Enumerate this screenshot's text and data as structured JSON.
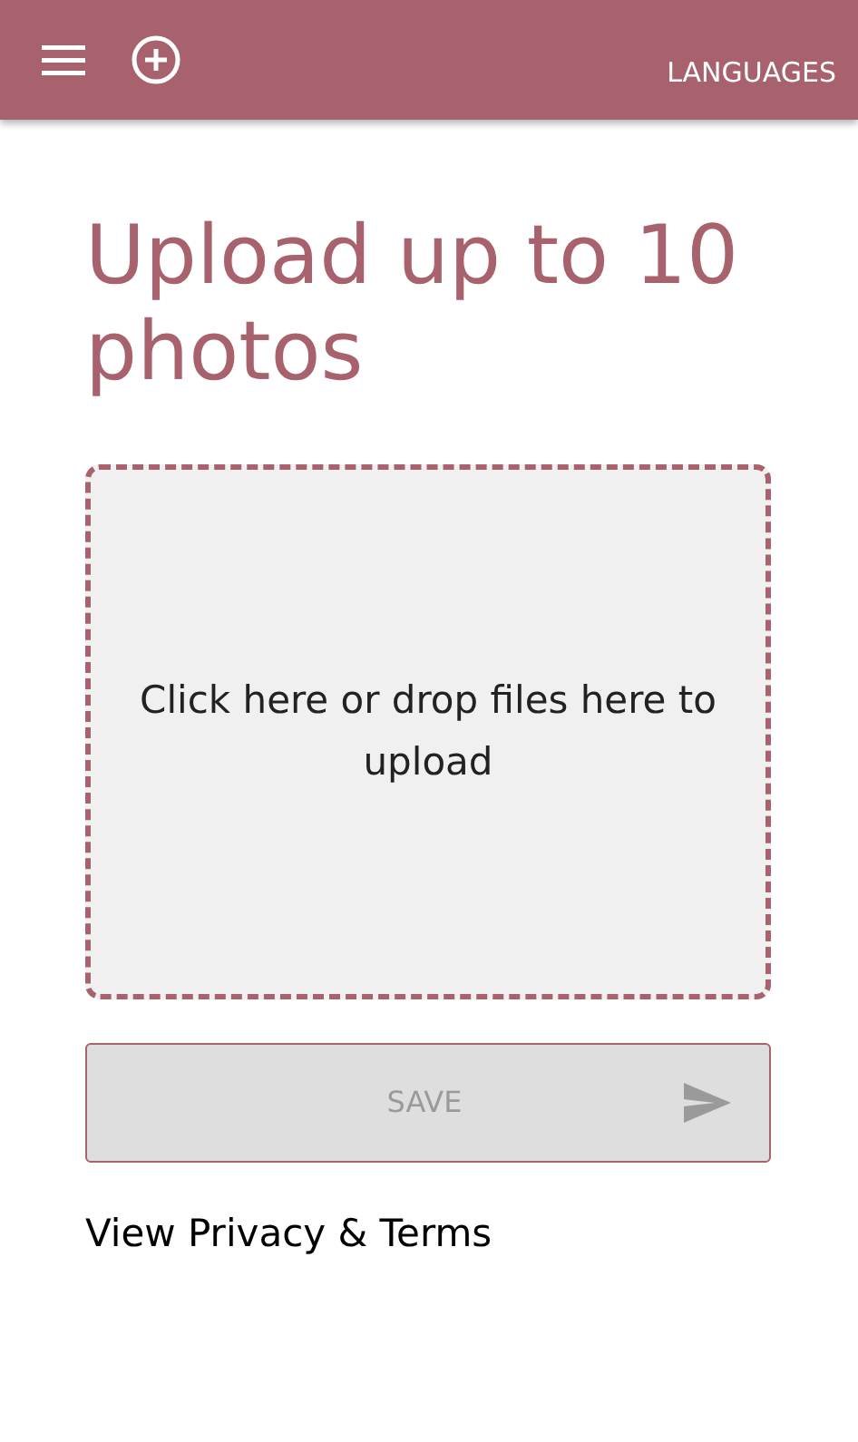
{
  "app_bar": {
    "languages_button": "LANGUAGES"
  },
  "heading": "Upload up to 10 photos",
  "dropzone": {
    "text": "Click here or drop files here to upload"
  },
  "save_button": {
    "label": "SAVE",
    "disabled": true
  },
  "privacy_link": "View Privacy & Terms"
}
